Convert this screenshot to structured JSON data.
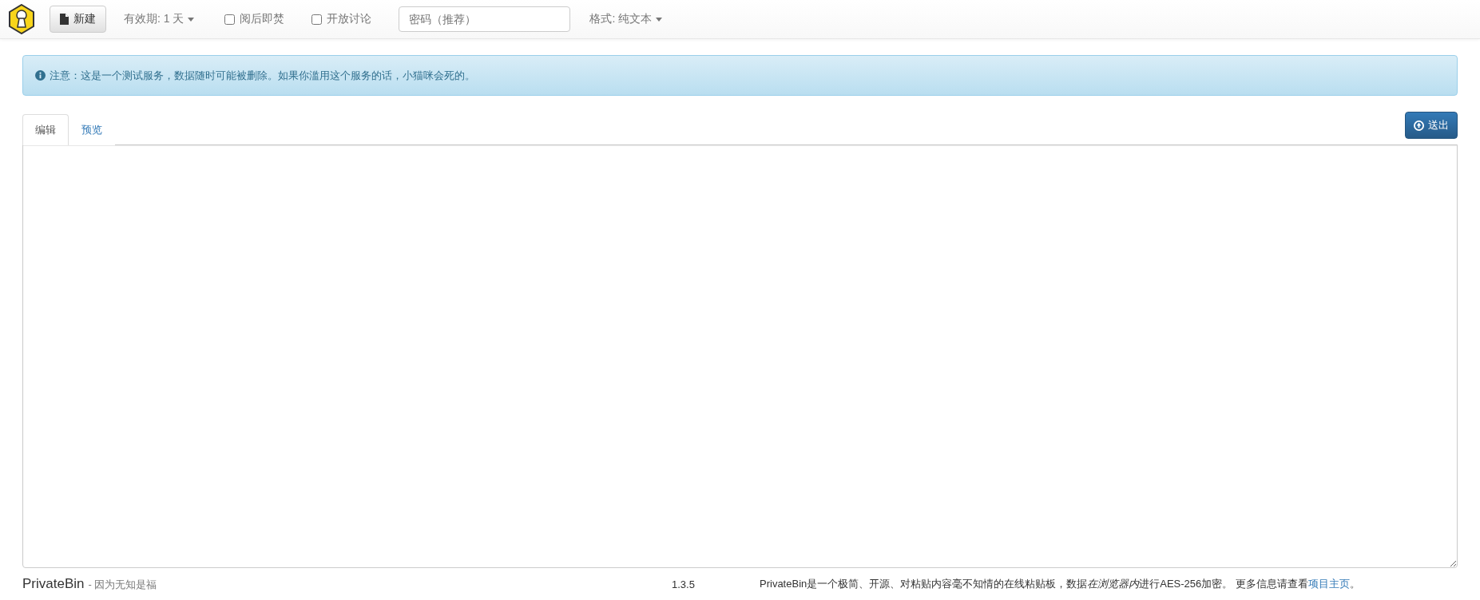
{
  "navbar": {
    "new_button": "新建",
    "expiration": "有效期: 1 天",
    "options": [
      {
        "label": "阅后即焚",
        "checked": false
      },
      {
        "label": "开放讨论",
        "checked": false
      }
    ],
    "password": {
      "placeholder": "密码（推荐）"
    },
    "format": "格式: 纯文本"
  },
  "alert": {
    "text": "注意：这是一个测试服务，数据随时可能被删除。如果你滥用这个服务的话，小猫咪会死的。"
  },
  "tabs": [
    {
      "label": "编辑",
      "selected": true
    },
    {
      "label": "预览",
      "selected": false
    }
  ],
  "send_button": "送出",
  "footer": {
    "brand": "PrivateBin",
    "slogan": "- 因为无知是福",
    "version": "1.3.5",
    "info": "PrivateBin是一个极简、开源、对粘贴内容毫不知情的在线粘贴板，数据",
    "info_italic": "在浏览器内",
    "info_rest": "进行AES-256加密。 更多信息请查看",
    "link": "项目主页",
    "info_end": "。"
  }
}
